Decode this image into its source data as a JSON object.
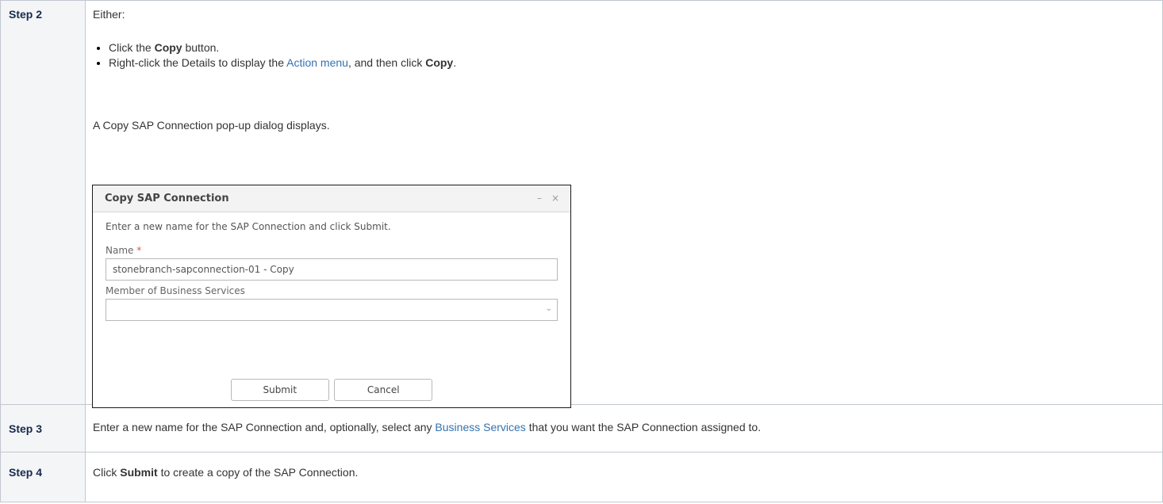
{
  "steps": [
    {
      "label": "Step 2",
      "intro": "Either:",
      "bullets": [
        {
          "pre": "Click the ",
          "bold": "Copy",
          "post": " button."
        },
        {
          "pre": "Right-click the Details to display the ",
          "link": "Action menu",
          "mid": ", and then click ",
          "bold": "Copy",
          "post": "."
        }
      ],
      "after_text": "A Copy SAP Connection pop-up dialog displays."
    },
    {
      "label": "Step 3",
      "pre": "Enter a new name for the SAP Connection and, optionally, select any ",
      "link": "Business Services",
      "post": " that you want the SAP Connection assigned to."
    },
    {
      "label": "Step 4",
      "pre": "Click ",
      "bold": "Submit",
      "post": " to create a copy of the SAP Connection."
    }
  ],
  "dialog": {
    "title": "Copy SAP Connection",
    "minimize_glyph": "–",
    "close_glyph": "×",
    "message": "Enter a new name for the SAP Connection and click Submit.",
    "name_label": "Name",
    "required_mark": "*",
    "name_value": "stonebranch-sapconnection-01 - Copy",
    "business_services_label": "Member of Business Services",
    "business_services_value": "",
    "chevron_glyph": "⌄",
    "submit_label": "Submit",
    "cancel_label": "Cancel"
  }
}
